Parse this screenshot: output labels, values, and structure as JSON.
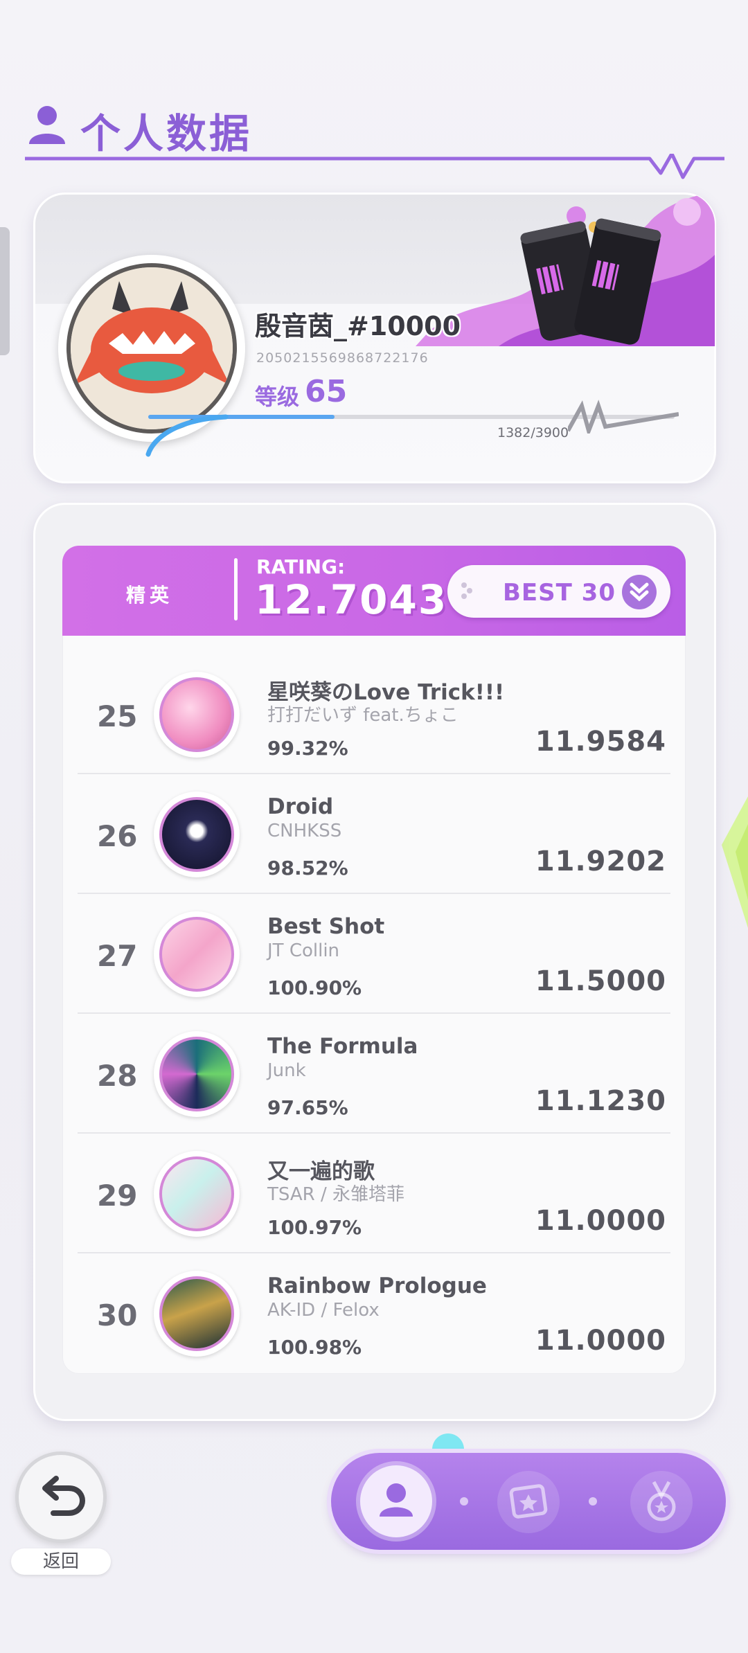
{
  "header": {
    "title": "个人数据"
  },
  "profile": {
    "username": "殷音茵_#10000",
    "user_id": "2050215569868722176",
    "level_label": "等级",
    "level": "65",
    "xp_text": "1382/3900",
    "xp_progress": 0.354
  },
  "rating": {
    "rank_label": "精英",
    "rating_label": "RATING:",
    "rating_value": "12.7043",
    "best_button": "BEST 30"
  },
  "songs": [
    {
      "rank": "25",
      "title": "星咲葵のLove Trick!!!",
      "artist": "打打だいず feat.ちょこ",
      "accuracy": "99.32%",
      "score": "11.9584",
      "cover_color": "#f3a9cf"
    },
    {
      "rank": "26",
      "title": "Droid",
      "artist": "CNHKSS",
      "accuracy": "98.52%",
      "score": "11.9202",
      "cover_color": "#1b1b3a"
    },
    {
      "rank": "27",
      "title": "Best Shot",
      "artist": "JT Collin",
      "accuracy": "100.90%",
      "score": "11.5000",
      "cover_color": "#f7b7d6"
    },
    {
      "rank": "28",
      "title": "The Formula",
      "artist": "Junk",
      "accuracy": "97.65%",
      "score": "11.1230",
      "cover_color": "#1a4a5a"
    },
    {
      "rank": "29",
      "title": "又一遍的歌",
      "artist": "TSAR / 永雏塔菲",
      "accuracy": "100.97%",
      "score": "11.0000",
      "cover_color": "#f6d3e2"
    },
    {
      "rank": "30",
      "title": "Rainbow Prologue",
      "artist": "AK-ID / Felox",
      "accuracy": "100.98%",
      "score": "11.0000",
      "cover_color": "#1f3b36"
    }
  ],
  "nav": {
    "back_label": "返回"
  },
  "colors": {
    "accent": "#9a6ae0",
    "banner": "#cf6ee7",
    "text": "#56565e"
  }
}
